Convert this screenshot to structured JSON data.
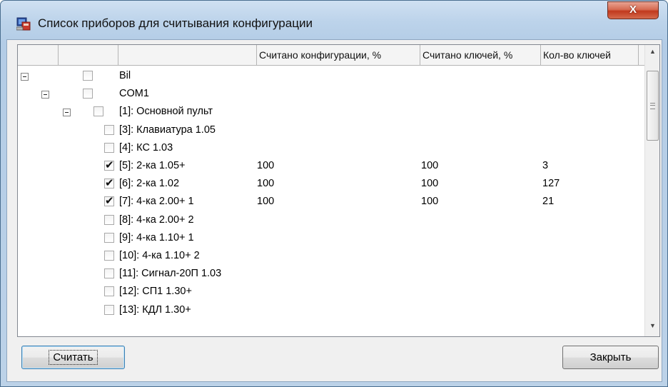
{
  "window": {
    "title": "Список приборов для считывания конфигурации",
    "close_label": "X"
  },
  "grid": {
    "columns": [
      "",
      "",
      "",
      "Считано конфигурации, %",
      "Считано ключей, %",
      "Кол-во ключей"
    ],
    "rows": [
      {
        "name": "Bil",
        "level": 0,
        "expander": true,
        "checked": false,
        "config": "",
        "keys": "",
        "count": ""
      },
      {
        "name": "COM1",
        "level": 1,
        "expander": true,
        "checked": false,
        "config": "",
        "keys": "",
        "count": ""
      },
      {
        "name": "[1]: Основной пульт",
        "level": 2,
        "expander": true,
        "checked": false,
        "config": "",
        "keys": "",
        "count": ""
      },
      {
        "name": "[3]: Клавиатура 1.05",
        "level": 3,
        "expander": false,
        "checked": false,
        "config": "",
        "keys": "",
        "count": ""
      },
      {
        "name": "[4]: КС 1.03",
        "level": 3,
        "expander": false,
        "checked": false,
        "config": "",
        "keys": "",
        "count": ""
      },
      {
        "name": "[5]: 2-ка 1.05+",
        "level": 3,
        "expander": false,
        "checked": true,
        "config": "100",
        "keys": "100",
        "count": "3"
      },
      {
        "name": "[6]: 2-ка 1.02",
        "level": 3,
        "expander": false,
        "checked": true,
        "config": "100",
        "keys": "100",
        "count": "127"
      },
      {
        "name": "[7]: 4-ка 2.00+ 1",
        "level": 3,
        "expander": false,
        "checked": true,
        "config": "100",
        "keys": "100",
        "count": "21"
      },
      {
        "name": "[8]: 4-ка 2.00+ 2",
        "level": 3,
        "expander": false,
        "checked": false,
        "config": "",
        "keys": "",
        "count": ""
      },
      {
        "name": "[9]: 4-ка 1.10+ 1",
        "level": 3,
        "expander": false,
        "checked": false,
        "config": "",
        "keys": "",
        "count": ""
      },
      {
        "name": "[10]: 4-ка 1.10+ 2",
        "level": 3,
        "expander": false,
        "checked": false,
        "config": "",
        "keys": "",
        "count": ""
      },
      {
        "name": "[11]: Сигнал-20П 1.03",
        "level": 3,
        "expander": false,
        "checked": false,
        "config": "",
        "keys": "",
        "count": ""
      },
      {
        "name": "[12]: СП1 1.30+",
        "level": 3,
        "expander": false,
        "checked": false,
        "config": "",
        "keys": "",
        "count": ""
      },
      {
        "name": "[13]: КДЛ 1.30+",
        "level": 3,
        "expander": false,
        "checked": false,
        "config": "",
        "keys": "",
        "count": ""
      }
    ]
  },
  "buttons": {
    "read_label": "Считать",
    "close_label": "Закрыть"
  },
  "icons": {
    "app": "computer-icon",
    "scroll_up": "arrow-up-icon",
    "scroll_down": "arrow-down-icon"
  }
}
